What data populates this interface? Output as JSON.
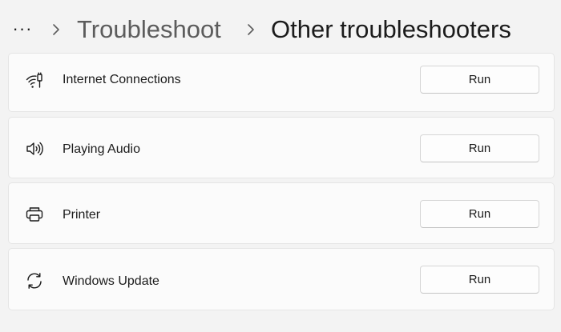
{
  "header": {
    "more_label": "···",
    "parent_crumb": "Troubleshoot",
    "current_crumb": "Other troubleshooters"
  },
  "troubleshooters": [
    {
      "label": "Internet Connections",
      "icon": "wifi-icon",
      "button": "Run"
    },
    {
      "label": "Playing Audio",
      "icon": "speaker-icon",
      "button": "Run"
    },
    {
      "label": "Printer",
      "icon": "printer-icon",
      "button": "Run"
    },
    {
      "label": "Windows Update",
      "icon": "sync-icon",
      "button": "Run"
    }
  ]
}
